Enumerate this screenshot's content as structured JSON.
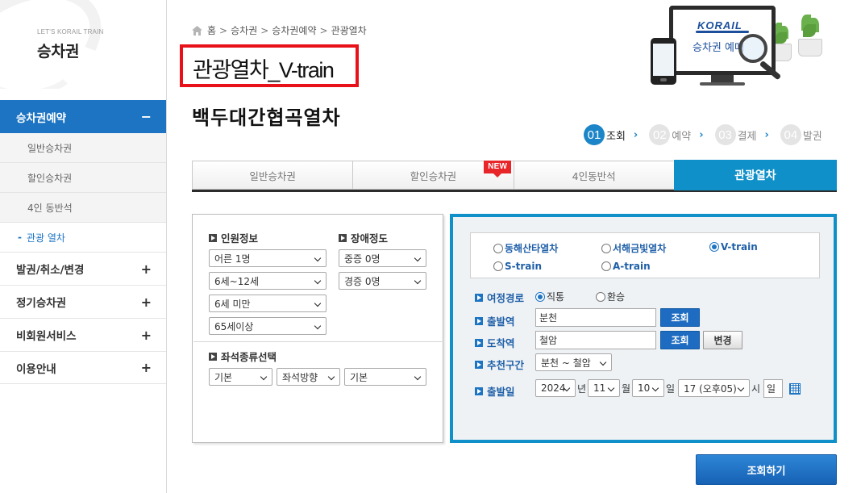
{
  "sidebar": {
    "tagline": "LET'S KORAIL TRAIN",
    "title": "승차권",
    "menu": [
      {
        "label": "승차권예약",
        "toggle": "−"
      },
      {
        "label": "발권/취소/변경",
        "toggle": "+"
      },
      {
        "label": "정기승차권",
        "toggle": "+"
      },
      {
        "label": "비회원서비스",
        "toggle": "+"
      },
      {
        "label": "이용안내",
        "toggle": "+"
      }
    ],
    "sub_items": [
      "일반승차권",
      "할인승차권",
      "4인 동반석"
    ],
    "current_sub": "관광 열차",
    "current_marker": "-"
  },
  "breadcrumb": {
    "items": [
      "홈",
      "승차권",
      "승차권예약",
      "관광열차"
    ],
    "sep": ">"
  },
  "page_title": "관광열차_V-train",
  "section_title": "백두대간협곡열차",
  "hero": {
    "logo": "KORAIL",
    "caption": "승차권 예매"
  },
  "steps": [
    {
      "num": "01",
      "label": "조회"
    },
    {
      "num": "02",
      "label": "예약"
    },
    {
      "num": "03",
      "label": "결제"
    },
    {
      "num": "04",
      "label": "발권"
    }
  ],
  "step_arrow": "›",
  "tabs": {
    "labels": [
      "일반승차권",
      "할인승차권",
      "4인동반석",
      "관광열차"
    ],
    "badge": "NEW",
    "active_index": 3
  },
  "passenger_section": {
    "title": "인원정보",
    "selects": [
      "어른 1명",
      "6세~12세",
      "6세 미만",
      "65세이상"
    ]
  },
  "disability_section": {
    "title": "장애정도",
    "selects": [
      "중증 0명",
      "경증 0명"
    ]
  },
  "seat_section": {
    "title": "좌석종류선택",
    "selects": [
      "기본",
      "좌석방향",
      "기본"
    ]
  },
  "trains": {
    "options": [
      "동해산타열차",
      "서해금빛열차",
      "V-train",
      "S-train",
      "A-train"
    ],
    "selected": "V-train"
  },
  "route": {
    "label": "여정경로",
    "options": [
      "직통",
      "환승"
    ],
    "selected": "직통"
  },
  "departure": {
    "label": "출발역",
    "value": "분천",
    "button": "조회"
  },
  "arrival": {
    "label": "도착역",
    "value": "철암",
    "button": "조회",
    "swap_button": "변경"
  },
  "recommend": {
    "label": "추천구간",
    "value": "분천 ~ 철암"
  },
  "date": {
    "label": "출발일",
    "year": "2024",
    "year_unit": "년",
    "month": "11",
    "month_unit": "월",
    "day": "10",
    "day_unit": "일",
    "hour": "17 (오후05)",
    "hour_unit": "시",
    "weekday": "일"
  },
  "search_button": "조회하기",
  "colors": {
    "primary": "#1d74c3",
    "tab_active": "#0f90c8",
    "highlight_border": "#e8111a",
    "new_badge": "#e8262a"
  }
}
